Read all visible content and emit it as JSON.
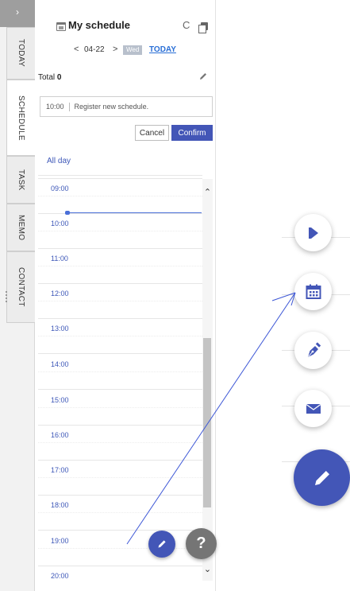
{
  "rail": {
    "collapse_glyph": "›",
    "tabs": [
      {
        "label": "TODAY"
      },
      {
        "label": "SCHEDULE"
      },
      {
        "label": "TASK"
      },
      {
        "label": "MEMO"
      },
      {
        "label": "CONTACT"
      }
    ]
  },
  "header": {
    "title": "My schedule",
    "refresh_glyph": "C"
  },
  "date_nav": {
    "prev_glyph": "<",
    "date": "04-22",
    "next_glyph": ">",
    "day_of_week": "Wed",
    "today_label": "TODAY"
  },
  "summary": {
    "total_label": "Total",
    "total_count": "0"
  },
  "new_schedule": {
    "time": "10:00",
    "placeholder": "Register new schedule.",
    "cancel_label": "Cancel",
    "confirm_label": "Confirm"
  },
  "timeline": {
    "allday_label": "All day",
    "hours": [
      "09:00",
      "10:00",
      "11:00",
      "12:00",
      "13:00",
      "14:00",
      "15:00",
      "16:00",
      "17:00",
      "18:00",
      "19:00",
      "20:00"
    ]
  },
  "help_button": {
    "label": "?"
  },
  "colors": {
    "accent": "#4356b7",
    "link": "#3d57b8",
    "now_line": "#4a6fd8",
    "help": "#757575"
  },
  "quick_menu": {
    "icons": [
      "flag-icon",
      "calendar-icon",
      "pen-nib-icon",
      "mail-icon",
      "pencil-icon"
    ]
  }
}
